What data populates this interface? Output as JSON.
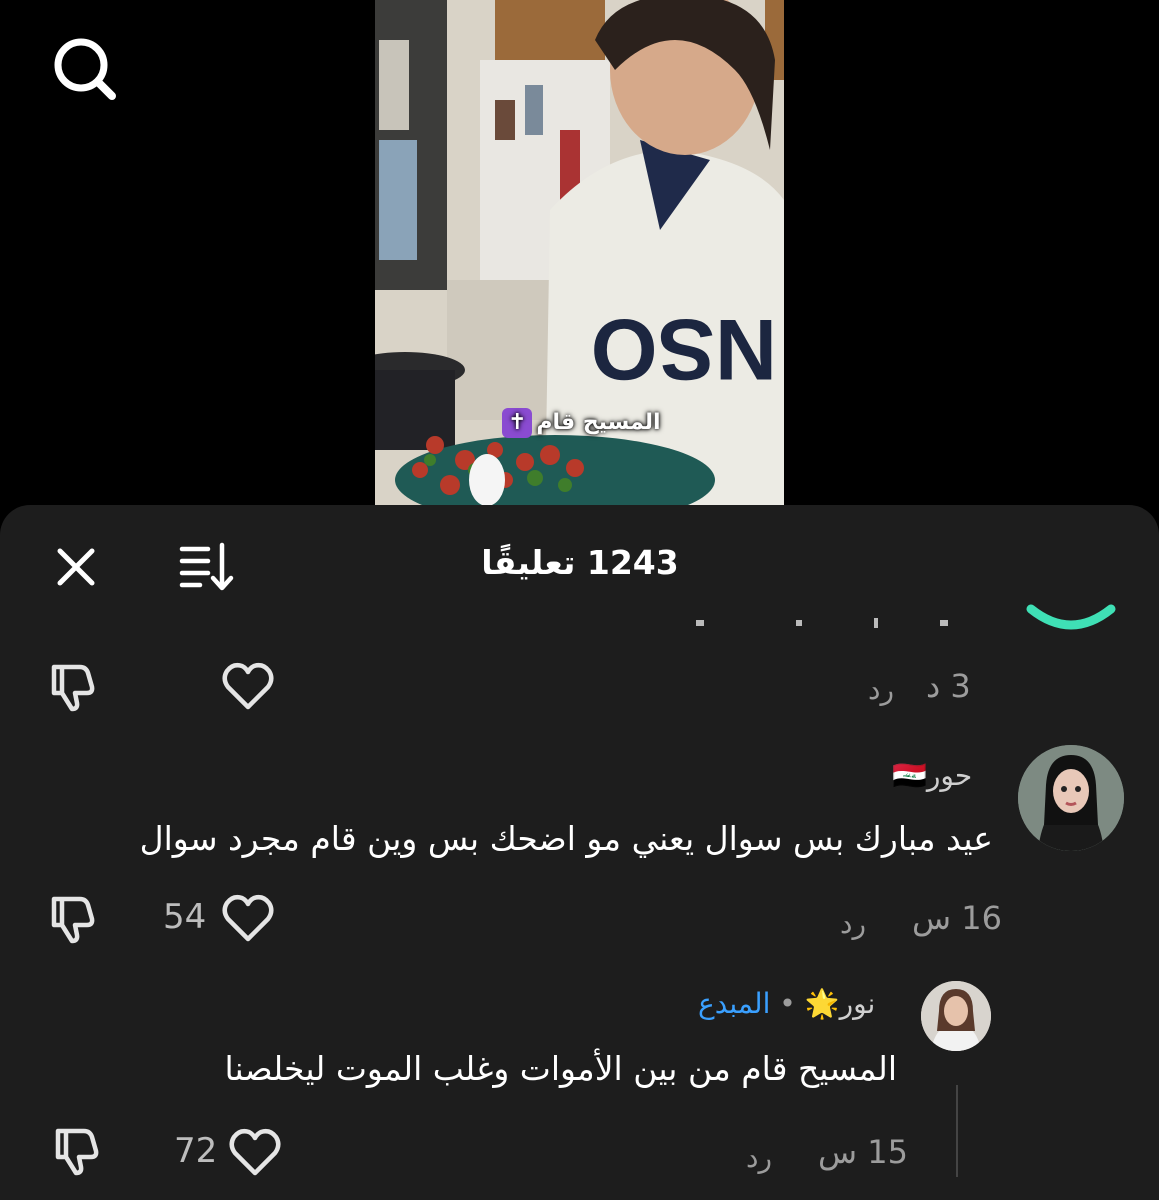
{
  "top": {
    "search_icon": "search-icon"
  },
  "video": {
    "caption": "المسيح قام",
    "caption_emoji": "✝"
  },
  "sheet": {
    "title": "1243 تعليقًا",
    "close_icon": "close-icon",
    "sort_icon": "sort-icon"
  },
  "comments": [
    {
      "time": "3 د",
      "reply": "رد",
      "likes": ""
    },
    {
      "username": "حور",
      "flag": "🇮🇶",
      "text": "عيد مبارك بس سوال يعني مو اضحك بس وين قام مجرد سوال",
      "time": "16 س",
      "reply": "رد",
      "likes": "54"
    },
    {
      "username": "نور",
      "badge": "🌟",
      "separator": "•",
      "creator_label": "المبدع",
      "text": "المسيح قام من بين الأموات وغلب الموت ليخلصنا",
      "time": "15 س",
      "reply": "رد",
      "likes": "72"
    }
  ],
  "colors": {
    "sheet_bg": "#1d1d1d",
    "creator_blue": "#3aa0ff",
    "cross_purple": "#8a4bd1"
  }
}
